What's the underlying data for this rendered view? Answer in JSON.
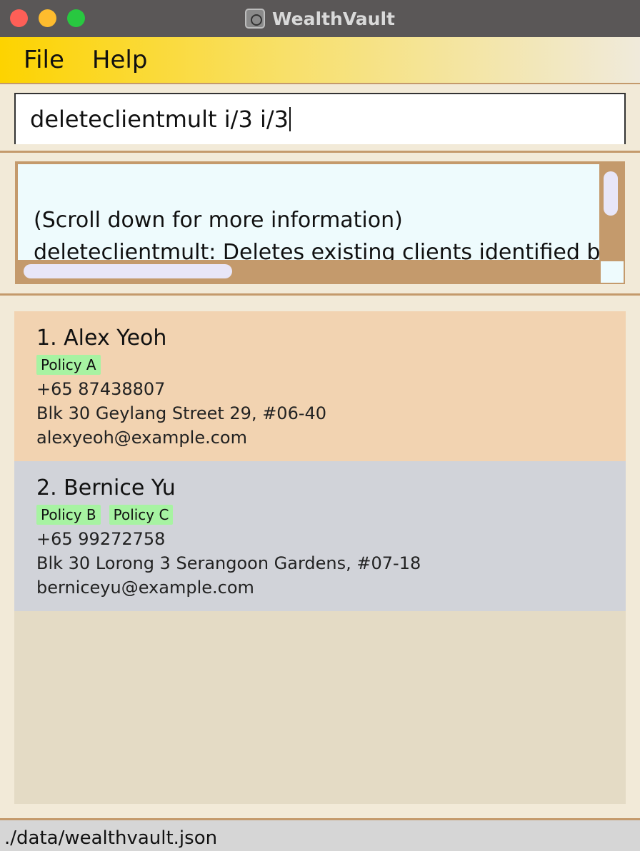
{
  "window": {
    "title": "WealthVault"
  },
  "menu": {
    "items": [
      "File",
      "Help"
    ]
  },
  "command": {
    "value": "deleteclientmult i/3 i/3"
  },
  "result": {
    "lines": [
      "(Scroll down for more information)",
      "deleteclientmult: Deletes existing clients identified by th"
    ]
  },
  "clients": [
    {
      "name": "1. Alex Yeoh",
      "tags": [
        "Policy A"
      ],
      "phone": "+65 87438807",
      "address": "Blk 30 Geylang Street 29, #06-40",
      "email": "alexyeoh@example.com"
    },
    {
      "name": "2. Bernice Yu",
      "tags": [
        "Policy B",
        "Policy C"
      ],
      "phone": "+65 99272758",
      "address": "Blk 30 Lorong 3 Serangoon Gardens, #07-18",
      "email": "berniceyu@example.com"
    }
  ],
  "status": {
    "path": "./data/wealthvault.json"
  },
  "colors": {
    "accent": "#c49a6c",
    "menu_gradient_start": "#fdd300",
    "card_selected": "#f2d3b1",
    "card_default": "#d1d3d9",
    "tag": "#a7f3a2"
  }
}
